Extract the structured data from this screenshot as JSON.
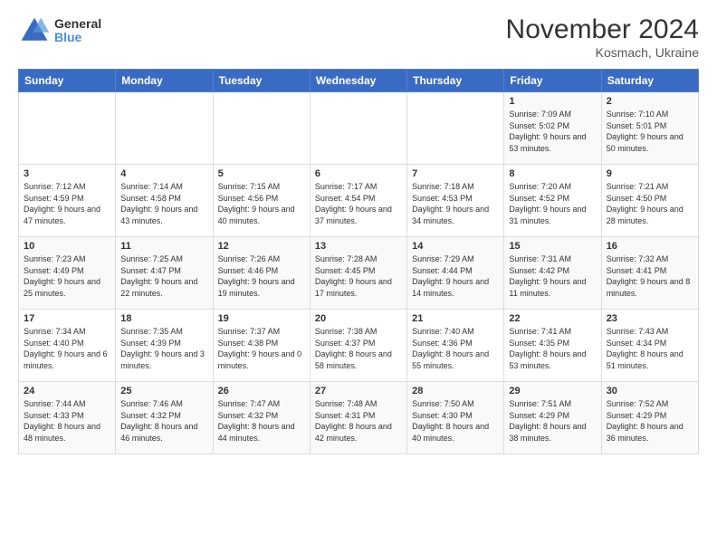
{
  "logo": {
    "general": "General",
    "blue": "Blue"
  },
  "header": {
    "month": "November 2024",
    "location": "Kosmach, Ukraine"
  },
  "weekdays": [
    "Sunday",
    "Monday",
    "Tuesday",
    "Wednesday",
    "Thursday",
    "Friday",
    "Saturday"
  ],
  "weeks": [
    [
      {
        "day": "",
        "info": ""
      },
      {
        "day": "",
        "info": ""
      },
      {
        "day": "",
        "info": ""
      },
      {
        "day": "",
        "info": ""
      },
      {
        "day": "",
        "info": ""
      },
      {
        "day": "1",
        "info": "Sunrise: 7:09 AM\nSunset: 5:02 PM\nDaylight: 9 hours and 53 minutes."
      },
      {
        "day": "2",
        "info": "Sunrise: 7:10 AM\nSunset: 5:01 PM\nDaylight: 9 hours and 50 minutes."
      }
    ],
    [
      {
        "day": "3",
        "info": "Sunrise: 7:12 AM\nSunset: 4:59 PM\nDaylight: 9 hours and 47 minutes."
      },
      {
        "day": "4",
        "info": "Sunrise: 7:14 AM\nSunset: 4:58 PM\nDaylight: 9 hours and 43 minutes."
      },
      {
        "day": "5",
        "info": "Sunrise: 7:15 AM\nSunset: 4:56 PM\nDaylight: 9 hours and 40 minutes."
      },
      {
        "day": "6",
        "info": "Sunrise: 7:17 AM\nSunset: 4:54 PM\nDaylight: 9 hours and 37 minutes."
      },
      {
        "day": "7",
        "info": "Sunrise: 7:18 AM\nSunset: 4:53 PM\nDaylight: 9 hours and 34 minutes."
      },
      {
        "day": "8",
        "info": "Sunrise: 7:20 AM\nSunset: 4:52 PM\nDaylight: 9 hours and 31 minutes."
      },
      {
        "day": "9",
        "info": "Sunrise: 7:21 AM\nSunset: 4:50 PM\nDaylight: 9 hours and 28 minutes."
      }
    ],
    [
      {
        "day": "10",
        "info": "Sunrise: 7:23 AM\nSunset: 4:49 PM\nDaylight: 9 hours and 25 minutes."
      },
      {
        "day": "11",
        "info": "Sunrise: 7:25 AM\nSunset: 4:47 PM\nDaylight: 9 hours and 22 minutes."
      },
      {
        "day": "12",
        "info": "Sunrise: 7:26 AM\nSunset: 4:46 PM\nDaylight: 9 hours and 19 minutes."
      },
      {
        "day": "13",
        "info": "Sunrise: 7:28 AM\nSunset: 4:45 PM\nDaylight: 9 hours and 17 minutes."
      },
      {
        "day": "14",
        "info": "Sunrise: 7:29 AM\nSunset: 4:44 PM\nDaylight: 9 hours and 14 minutes."
      },
      {
        "day": "15",
        "info": "Sunrise: 7:31 AM\nSunset: 4:42 PM\nDaylight: 9 hours and 11 minutes."
      },
      {
        "day": "16",
        "info": "Sunrise: 7:32 AM\nSunset: 4:41 PM\nDaylight: 9 hours and 8 minutes."
      }
    ],
    [
      {
        "day": "17",
        "info": "Sunrise: 7:34 AM\nSunset: 4:40 PM\nDaylight: 9 hours and 6 minutes."
      },
      {
        "day": "18",
        "info": "Sunrise: 7:35 AM\nSunset: 4:39 PM\nDaylight: 9 hours and 3 minutes."
      },
      {
        "day": "19",
        "info": "Sunrise: 7:37 AM\nSunset: 4:38 PM\nDaylight: 9 hours and 0 minutes."
      },
      {
        "day": "20",
        "info": "Sunrise: 7:38 AM\nSunset: 4:37 PM\nDaylight: 8 hours and 58 minutes."
      },
      {
        "day": "21",
        "info": "Sunrise: 7:40 AM\nSunset: 4:36 PM\nDaylight: 8 hours and 55 minutes."
      },
      {
        "day": "22",
        "info": "Sunrise: 7:41 AM\nSunset: 4:35 PM\nDaylight: 8 hours and 53 minutes."
      },
      {
        "day": "23",
        "info": "Sunrise: 7:43 AM\nSunset: 4:34 PM\nDaylight: 8 hours and 51 minutes."
      }
    ],
    [
      {
        "day": "24",
        "info": "Sunrise: 7:44 AM\nSunset: 4:33 PM\nDaylight: 8 hours and 48 minutes."
      },
      {
        "day": "25",
        "info": "Sunrise: 7:46 AM\nSunset: 4:32 PM\nDaylight: 8 hours and 46 minutes."
      },
      {
        "day": "26",
        "info": "Sunrise: 7:47 AM\nSunset: 4:32 PM\nDaylight: 8 hours and 44 minutes."
      },
      {
        "day": "27",
        "info": "Sunrise: 7:48 AM\nSunset: 4:31 PM\nDaylight: 8 hours and 42 minutes."
      },
      {
        "day": "28",
        "info": "Sunrise: 7:50 AM\nSunset: 4:30 PM\nDaylight: 8 hours and 40 minutes."
      },
      {
        "day": "29",
        "info": "Sunrise: 7:51 AM\nSunset: 4:29 PM\nDaylight: 8 hours and 38 minutes."
      },
      {
        "day": "30",
        "info": "Sunrise: 7:52 AM\nSunset: 4:29 PM\nDaylight: 8 hours and 36 minutes."
      }
    ]
  ]
}
